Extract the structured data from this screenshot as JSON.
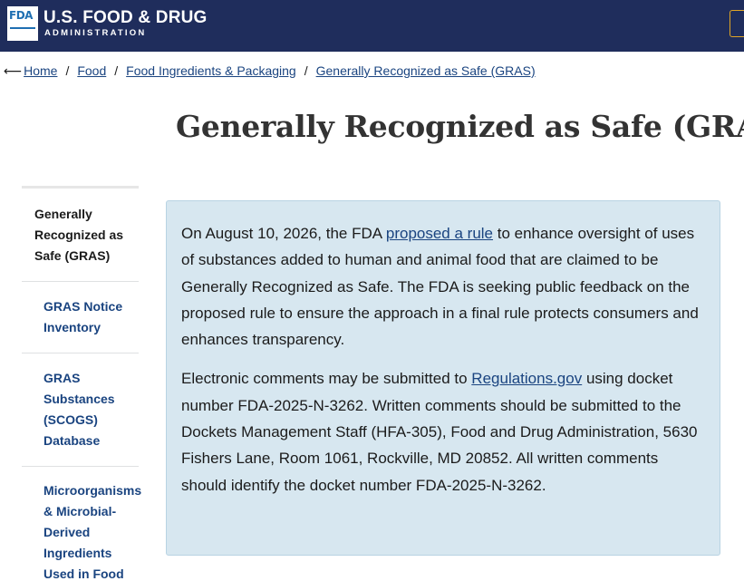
{
  "header": {
    "logo_text": "FDA",
    "agency_name": "U.S. FOOD & DRUG",
    "agency_sub": "ADMINISTRATION"
  },
  "breadcrumb": {
    "arrow": "⟵",
    "items": [
      "Home",
      "Food",
      "Food Ingredients & Packaging",
      "Generally Recognized as Safe (GRAS)"
    ],
    "separator": "/"
  },
  "page": {
    "title": "Generally Recognized as Safe (GRAS)"
  },
  "sidenav": {
    "items": [
      {
        "label": "Generally Recognized as Safe (GRAS)"
      },
      {
        "label": "GRAS Notice Inventory"
      },
      {
        "label": "GRAS Substances (SCOGS) Database"
      },
      {
        "label": "Microorganisms & Microbial-Derived Ingredients Used in Food"
      }
    ]
  },
  "alert": {
    "p1_before": "On August 10, 2026, the FDA ",
    "p1_link": "proposed a rule",
    "p1_after": " to enhance oversight of uses of substances added to human and animal food that are claimed to be Generally Recognized as Safe. The FDA is seeking public feedback on the proposed rule to ensure the approach in a final rule protects consumers and enhances transparency.",
    "p2_before": "Electronic comments may be submitted to ",
    "p2_link": "Regulations.gov",
    "p2_after": " using docket number FDA-2025-N-3262. Written comments should be submitted to the Dockets Management Staff (HFA-305), Food and Drug Administration, 5630 Fishers Lane, Room 1061, Rockville, MD 20852. All written comments should identify the docket number FDA-2025-N-3262."
  },
  "colors": {
    "header_bg": "#1f2d5c",
    "link": "#1a4480",
    "alert_bg": "#d7e7f0",
    "search_border": "#e0a526"
  }
}
